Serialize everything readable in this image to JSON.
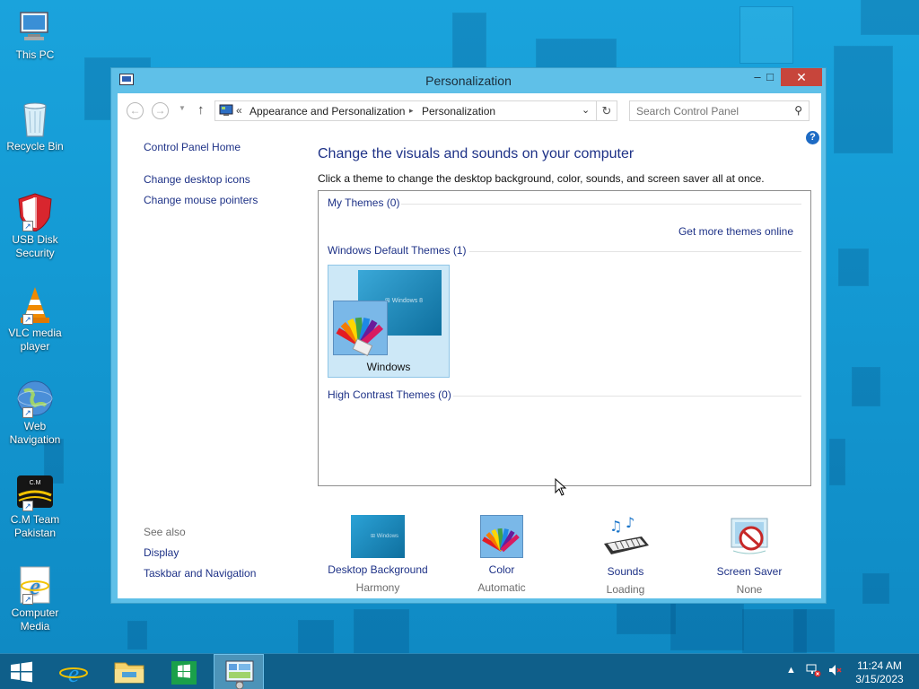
{
  "window": {
    "title": "Personalization",
    "minimize": "–",
    "maximize": "□",
    "close": "✕"
  },
  "navbar": {
    "chevrons": "«",
    "breadcrumb": [
      "Appearance and Personalization",
      "Personalization"
    ],
    "separator": "▸",
    "search_placeholder": "Search Control Panel"
  },
  "left_pane": {
    "home": "Control Panel Home",
    "links": [
      "Change desktop icons",
      "Change mouse pointers"
    ],
    "see_also_title": "See also",
    "see_also": [
      "Display",
      "Taskbar and Navigation"
    ]
  },
  "main": {
    "heading": "Change the visuals and sounds on your computer",
    "subtext": "Click a theme to change the desktop background, color, sounds, and screen saver all at once.",
    "my_themes": "My Themes (0)",
    "get_more": "Get more themes online",
    "default_themes": "Windows Default Themes (1)",
    "theme_name": "Windows",
    "high_contrast": "High Contrast Themes (0)"
  },
  "bottom_items": [
    {
      "label": "Desktop Background",
      "value": "Harmony"
    },
    {
      "label": "Color",
      "value": "Automatic"
    },
    {
      "label": "Sounds",
      "value": "Loading"
    },
    {
      "label": "Screen Saver",
      "value": "None"
    }
  ],
  "desktop_icons": [
    {
      "label": "This PC",
      "icon": "computer-icon"
    },
    {
      "label": "Recycle Bin",
      "icon": "recycle-bin-icon"
    },
    {
      "label": "USB Disk Security",
      "icon": "shield-icon"
    },
    {
      "label": "VLC media player",
      "icon": "vlc-cone-icon"
    },
    {
      "label": "Web Navigation",
      "icon": "globe-icon"
    },
    {
      "label": "C.M Team Pakistan",
      "icon": "cm-team-icon"
    },
    {
      "label": "Computer Media",
      "icon": "internet-explorer-icon"
    }
  ],
  "taskbar": {
    "time": "11:24 AM",
    "date": "3/15/2023",
    "items": [
      "start-icon",
      "internet-explorer-icon",
      "file-explorer-icon",
      "store-icon",
      "control-panel-icon"
    ]
  },
  "colors": {
    "desktop": "#149ad4",
    "window_frame": "#5fc0e8",
    "close_button": "#c7453b",
    "link": "#1e3287",
    "taskbar": "#0f5f8a"
  }
}
